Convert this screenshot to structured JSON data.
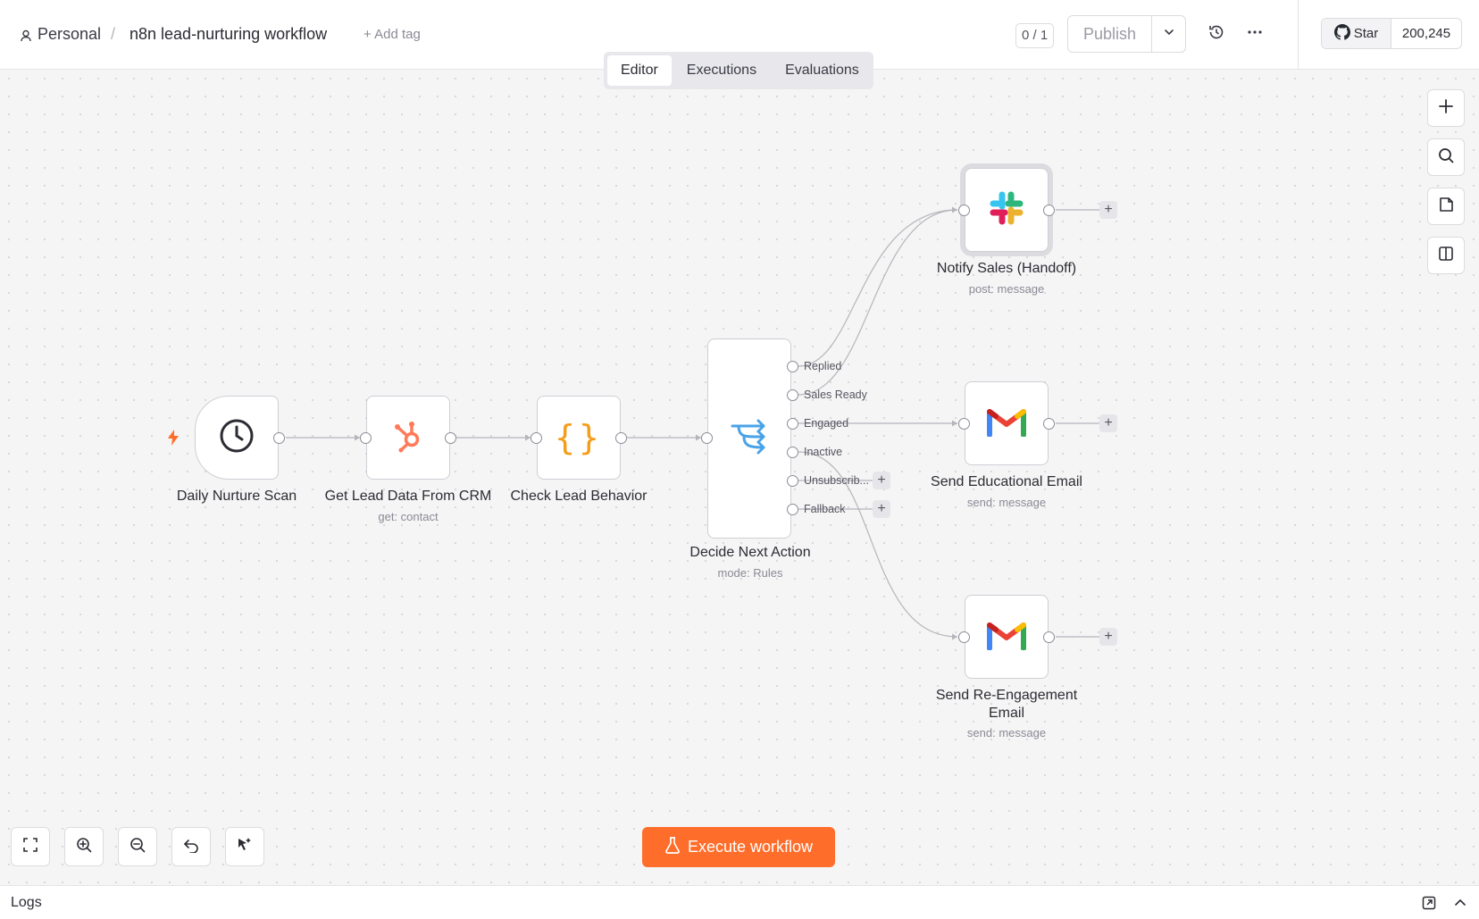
{
  "breadcrumb": {
    "project": "Personal",
    "separator": "/",
    "workflow": "n8n lead-nurturing workflow",
    "add_tag": "+ Add tag"
  },
  "header": {
    "counter": "0 / 1",
    "publish": "Publish",
    "github_star": "Star",
    "github_count": "200,245"
  },
  "tabs": [
    {
      "label": "Editor",
      "active": true
    },
    {
      "label": "Executions"
    },
    {
      "label": "Evaluations"
    }
  ],
  "nodes": {
    "daily_scan": {
      "label": "Daily Nurture Scan",
      "icon": "clock-icon"
    },
    "get_lead": {
      "label": "Get Lead Data From CRM",
      "sub": "get: contact",
      "icon": "hubspot-icon"
    },
    "check_behavior": {
      "label": "Check Lead Behavior",
      "icon": "code-braces-icon"
    },
    "decide": {
      "label": "Decide Next Action",
      "sub": "mode: Rules",
      "icon": "switch-icon",
      "outputs": [
        "Replied",
        "Sales Ready",
        "Engaged",
        "Inactive",
        "Unsubscrib...",
        "Fallback"
      ]
    },
    "notify_sales": {
      "label": "Notify Sales (Handoff)",
      "sub": "post: message",
      "icon": "slack-icon"
    },
    "send_edu": {
      "label": "Send Educational Email",
      "sub": "send: message",
      "icon": "gmail-icon"
    },
    "send_reengage": {
      "label_line1": "Send Re-Engagement",
      "label_line2": "Email",
      "sub": "send: message",
      "icon": "gmail-icon"
    }
  },
  "canvas_controls": [
    "fit-view-icon",
    "zoom-in-icon",
    "zoom-out-icon",
    "reset-zoom-icon",
    "tidy-up-icon"
  ],
  "side_controls": [
    "add-node-icon",
    "search-icon",
    "sticky-note-icon",
    "panel-icon"
  ],
  "execute": {
    "label": "Execute workflow"
  },
  "logs": {
    "label": "Logs"
  },
  "colors": {
    "accent": "#ff6d2a",
    "hubspot": "#ff7a59",
    "code": "#f59d1a",
    "switch": "#4aa3e8",
    "gmail_red": "#ea4335"
  }
}
